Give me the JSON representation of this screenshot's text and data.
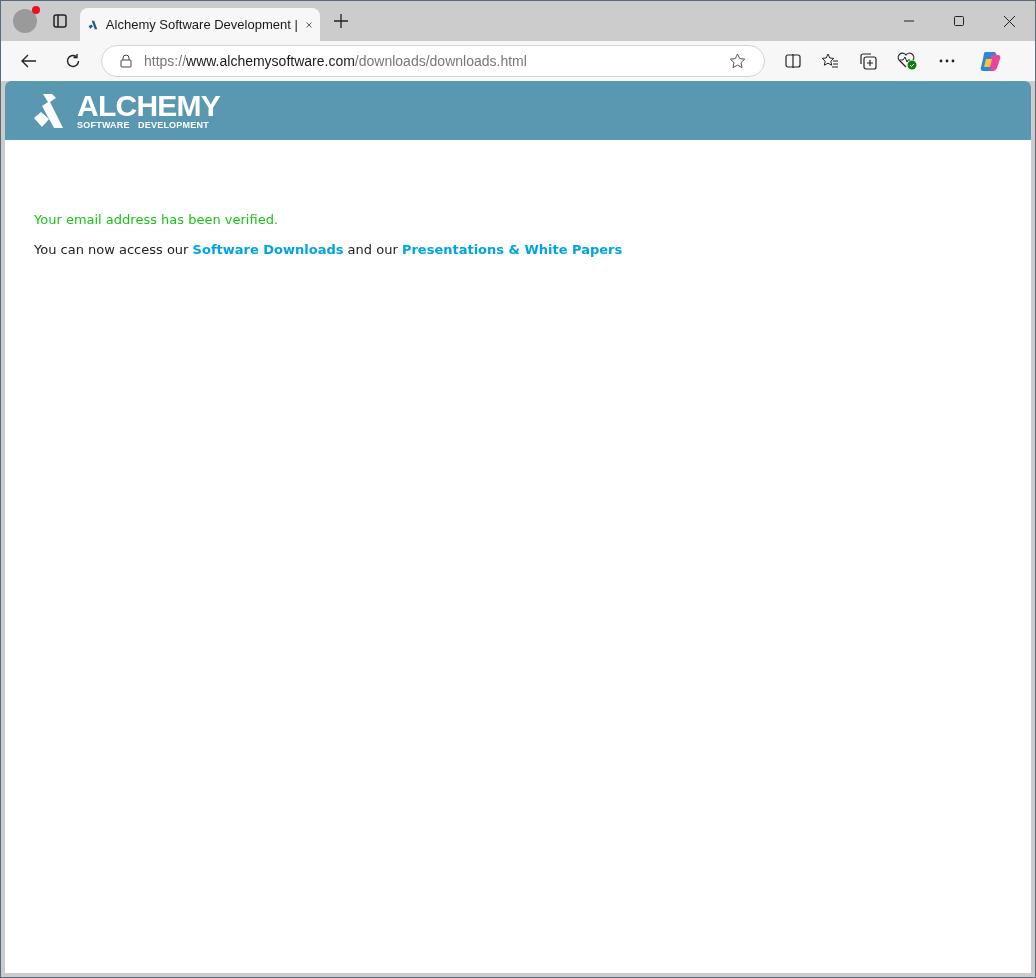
{
  "browser": {
    "tab": {
      "title": "Alchemy Software Development |",
      "selected": true
    },
    "address": {
      "scheme": "https://",
      "host": "www.alchemysoftware.com",
      "path": "/downloads/downloads.html"
    }
  },
  "header": {
    "logo_title": "ALCHEMY",
    "logo_subtitle": "SOFTWARE   DEVELOPMENT"
  },
  "message": "Your email address has been verified.",
  "paragraph": [
    {
      "kind": "text",
      "text": "You can now access our "
    },
    {
      "kind": "link",
      "text": "Software Downloads"
    },
    {
      "kind": "text",
      "text": " and our "
    },
    {
      "kind": "link",
      "text": "Presentations & White Papers"
    }
  ]
}
